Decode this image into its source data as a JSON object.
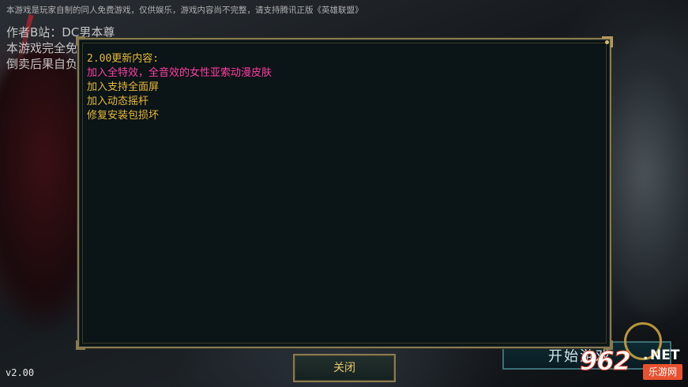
{
  "background": {
    "top_notice": "本游戏是玩家自制的同人免费游戏，仅供娱乐，游戏内容尚不完整，请支持腾讯正版《英雄联盟》",
    "credits": [
      "作者B站：DC男本尊",
      "本游戏完全免费",
      "倒卖后果自负"
    ],
    "version": "v2.00",
    "start_button_label": "开始游戏"
  },
  "dialog": {
    "title": "2.00更新内容:",
    "lines": [
      {
        "text": "加入全特效，全音效的女性亚索动漫皮肤",
        "highlight": true
      },
      {
        "text": "加入支持全面屏",
        "highlight": false
      },
      {
        "text": "加入动态摇杆",
        "highlight": false
      },
      {
        "text": "修复安装包损坏",
        "highlight": false
      }
    ],
    "close_label": "关闭"
  },
  "watermark": {
    "number": "962",
    "dot": ".",
    "tld": "NET",
    "site_name": "乐游网"
  },
  "colors": {
    "accent_gold": "#e8b93a",
    "highlight_pink": "#ff3fa4",
    "frame_gold": "#8a7a4e",
    "panel_bg": "#0b1416"
  }
}
